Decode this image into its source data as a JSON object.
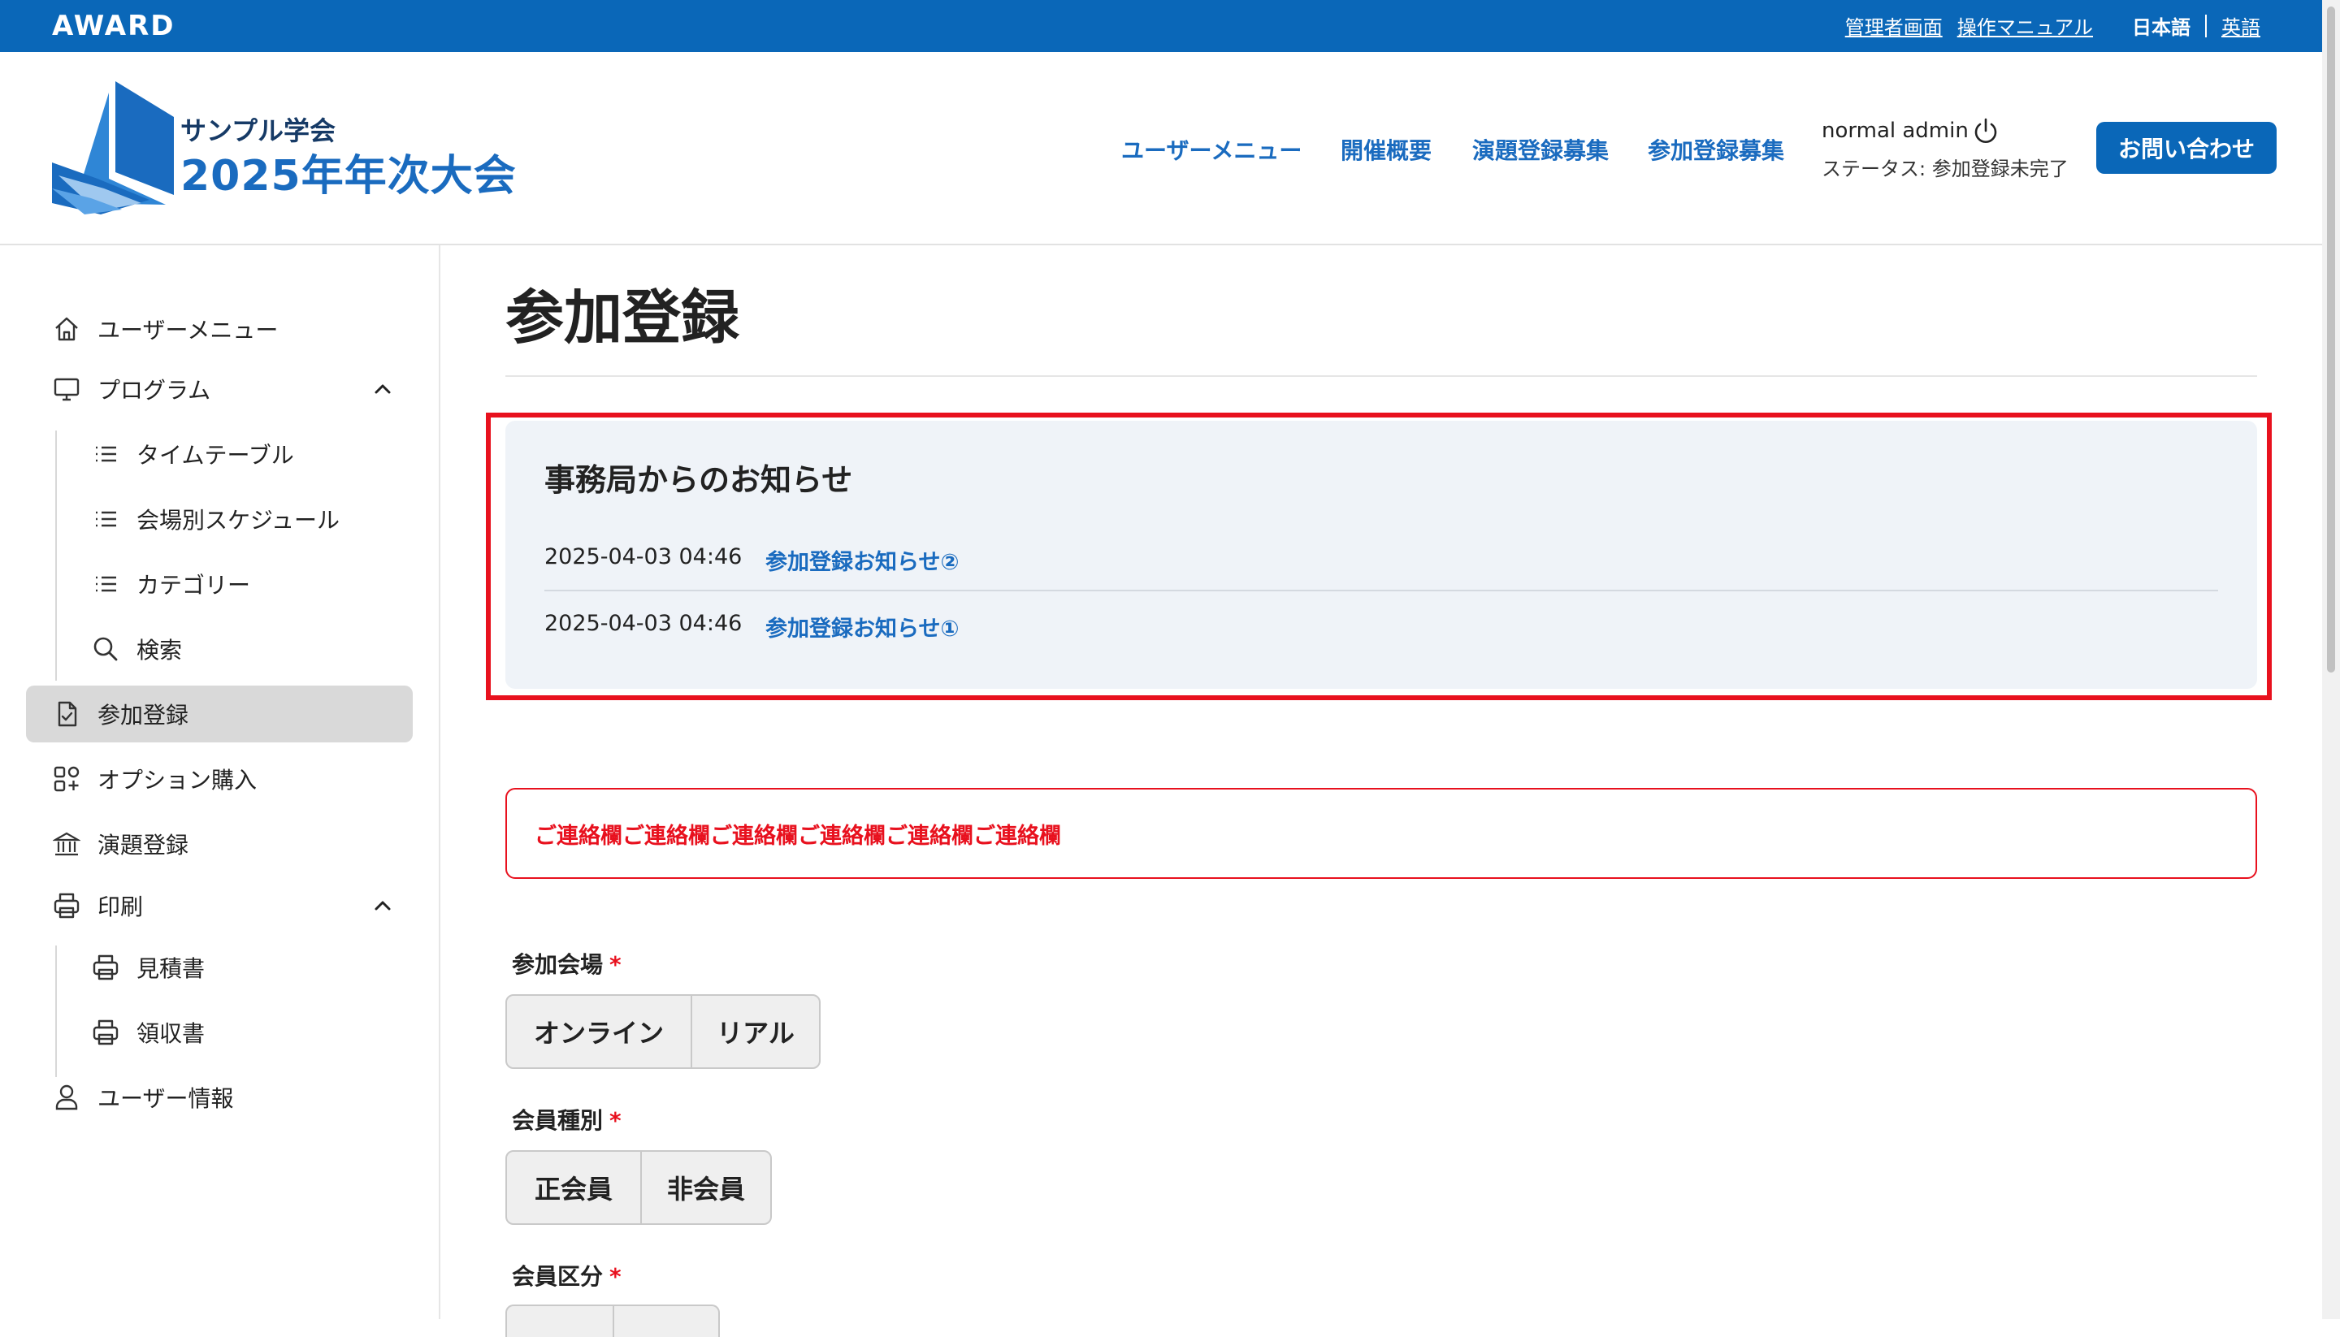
{
  "topbar": {
    "brand": "AWARD",
    "admin_link": "管理者画面",
    "manual_link": "操作マニュアル",
    "lang_current": "日本語",
    "lang_en": "英語"
  },
  "header": {
    "logo_sub": "サンプル学会",
    "logo_main": "2025年年次大会",
    "nav": [
      "ユーザーメニュー",
      "開催概要",
      "演題登録募集",
      "参加登録募集"
    ],
    "user_name": "normal admin",
    "user_status": "ステータス: 参加登録未完了",
    "contact_button": "お問い合わせ"
  },
  "sidebar": {
    "items": [
      {
        "label": "ユーザーメニュー",
        "icon": "home-icon"
      },
      {
        "label": "プログラム",
        "icon": "monitor-icon"
      },
      {
        "label": "タイムテーブル",
        "icon": "list-icon"
      },
      {
        "label": "会場別スケジュール",
        "icon": "list-icon"
      },
      {
        "label": "カテゴリー",
        "icon": "list-icon"
      },
      {
        "label": "検索",
        "icon": "search-icon"
      },
      {
        "label": "参加登録",
        "icon": "document-check-icon"
      },
      {
        "label": "オプション購入",
        "icon": "apps-add-icon"
      },
      {
        "label": "演題登録",
        "icon": "building-icon"
      },
      {
        "label": "印刷",
        "icon": "printer-icon"
      },
      {
        "label": "見積書",
        "icon": "printer-icon"
      },
      {
        "label": "領収書",
        "icon": "printer-icon"
      },
      {
        "label": "ユーザー情報",
        "icon": "user-icon"
      }
    ]
  },
  "main": {
    "title": "参加登録",
    "notice": {
      "title": "事務局からのお知らせ",
      "rows": [
        {
          "date": "2025-04-03 04:46",
          "link": "参加登録お知らせ②"
        },
        {
          "date": "2025-04-03 04:46",
          "link": "参加登録お知らせ①"
        }
      ]
    },
    "contact_note": "ご連絡欄ご連絡欄ご連絡欄ご連絡欄ご連絡欄ご連絡欄",
    "fields": [
      {
        "label": "参加会場",
        "required": "*",
        "options": [
          "オンライン",
          "リアル"
        ]
      },
      {
        "label": "会員種別",
        "required": "*",
        "options": [
          "正会員",
          "非会員"
        ]
      },
      {
        "label": "会員区分",
        "required": "*",
        "options": []
      }
    ]
  },
  "colors": {
    "brand_blue": "#0a67b8",
    "link_blue": "#1a6bbf",
    "alert_red": "#e8111e",
    "notice_bg": "#eff3f8"
  }
}
